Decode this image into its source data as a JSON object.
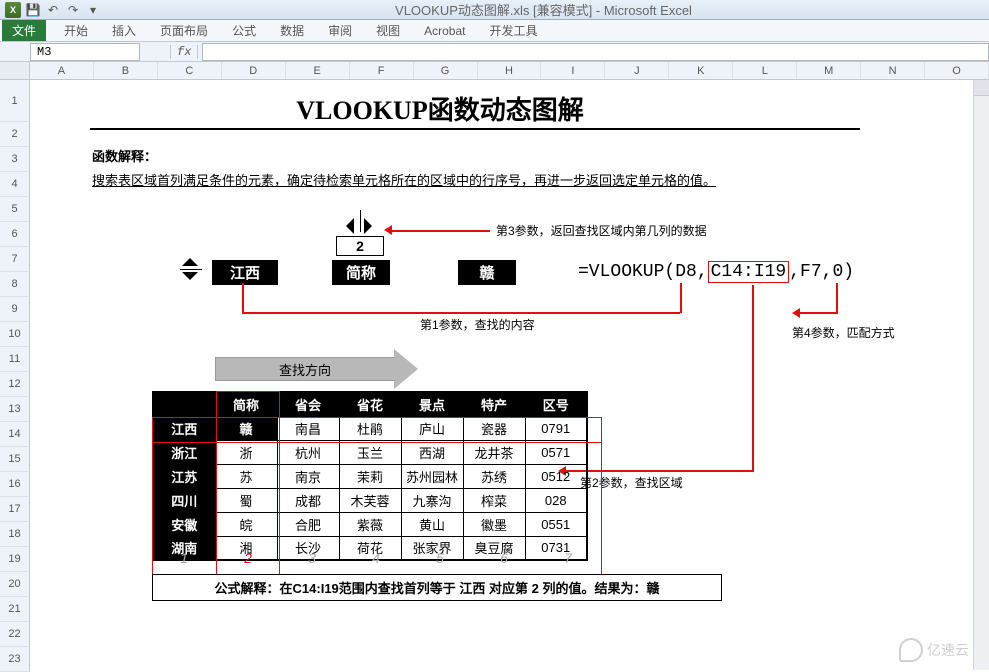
{
  "app": {
    "title_file": "VLOOKUP动态图解.xls",
    "title_mode": "[兼容模式]",
    "title_app": "- Microsoft Excel"
  },
  "ribbon": {
    "file": "文件",
    "tabs": [
      "开始",
      "插入",
      "页面布局",
      "公式",
      "数据",
      "审阅",
      "视图",
      "Acrobat",
      "开发工具"
    ]
  },
  "namebox": {
    "value": "M3",
    "fx": "fx"
  },
  "columns": [
    "A",
    "B",
    "C",
    "D",
    "E",
    "F",
    "G",
    "H",
    "I",
    "J",
    "K",
    "L",
    "M",
    "N",
    "O"
  ],
  "rows": [
    "1",
    "2",
    "3",
    "4",
    "5",
    "6",
    "7",
    "8",
    "9",
    "10",
    "11",
    "12",
    "13",
    "14",
    "15",
    "16",
    "17",
    "18",
    "19",
    "20",
    "21",
    "22",
    "23"
  ],
  "doc": {
    "title": "VLOOKUP函数动态图解",
    "fn_label": "函数解释：",
    "fn_desc": "搜索表区域首列满足条件的元素，确定待检索单元格所在的区域中的行序号，再进一步返回选定单元格的值。",
    "box_province": "江西",
    "box_colnum": "2",
    "box_abbr_label": "简称",
    "box_result": "赣",
    "formula": "=VLOOKUP(D8,C14:I19,F7,0)",
    "formula_parts": {
      "pre": "=VLOOKUP(D8,",
      "range": "C14:I19",
      "mid": ",F7,0)"
    },
    "note_param1": "第1参数，查找的内容",
    "note_param2": "第2参数，查找区域",
    "note_param3": "第3参数，返回查找区域内第几列的数据",
    "note_param4": "第4参数，匹配方式",
    "search_dir": "查找方向",
    "col_numbers": [
      "1",
      "2",
      "3",
      "4",
      "5",
      "6",
      "7"
    ],
    "active_col": 2,
    "explain": "公式解释：在C14:I19范围内查找首列等于 江西 对应第 2 列的值。结果为：赣"
  },
  "table": {
    "headers": [
      "",
      "简称",
      "省会",
      "省花",
      "景点",
      "特产",
      "区号"
    ],
    "rows": [
      [
        "江西",
        "赣",
        "南昌",
        "杜鹃",
        "庐山",
        "瓷器",
        "0791"
      ],
      [
        "浙江",
        "浙",
        "杭州",
        "玉兰",
        "西湖",
        "龙井茶",
        "0571"
      ],
      [
        "江苏",
        "苏",
        "南京",
        "茉莉",
        "苏州园林",
        "苏绣",
        "0512"
      ],
      [
        "四川",
        "蜀",
        "成都",
        "木芙蓉",
        "九寨沟",
        "榨菜",
        "028"
      ],
      [
        "安徽",
        "皖",
        "合肥",
        "紫薇",
        "黄山",
        "徽墨",
        "0551"
      ],
      [
        "湖南",
        "湘",
        "长沙",
        "荷花",
        "张家界",
        "臭豆腐",
        "0731"
      ]
    ]
  },
  "watermark": "亿速云"
}
